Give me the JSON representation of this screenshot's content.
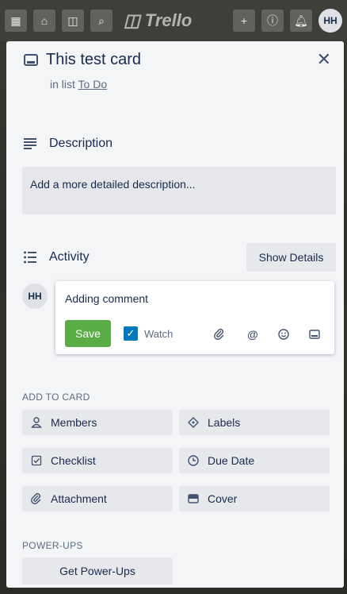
{
  "header": {
    "logo_text": "Trello",
    "avatar_initials": "HH"
  },
  "card": {
    "title": "This test card",
    "in_list_prefix": "in list",
    "list_name": "To Do",
    "description": {
      "heading": "Description",
      "placeholder": "Add a more detailed description..."
    },
    "activity": {
      "heading": "Activity",
      "show_details_label": "Show Details",
      "avatar_initials": "HH",
      "comment_text": "Adding comment",
      "save_label": "Save",
      "watch_label": "Watch"
    },
    "add_to_card": {
      "heading": "ADD TO CARD",
      "buttons": [
        {
          "label": "Members",
          "icon": "person-icon"
        },
        {
          "label": "Labels",
          "icon": "tag-icon"
        },
        {
          "label": "Checklist",
          "icon": "checklist-icon"
        },
        {
          "label": "Due Date",
          "icon": "clock-icon"
        },
        {
          "label": "Attachment",
          "icon": "paperclip-icon"
        },
        {
          "label": "Cover",
          "icon": "cover-icon"
        }
      ]
    },
    "powerups": {
      "heading": "POWER-UPS",
      "button_label": "Get Power-Ups"
    }
  },
  "colors": {
    "save_button": "#5aac44",
    "checkbox": "#0079bf",
    "panel_bg": "#f4f5f7",
    "button_bg": "#e6e8eb"
  }
}
